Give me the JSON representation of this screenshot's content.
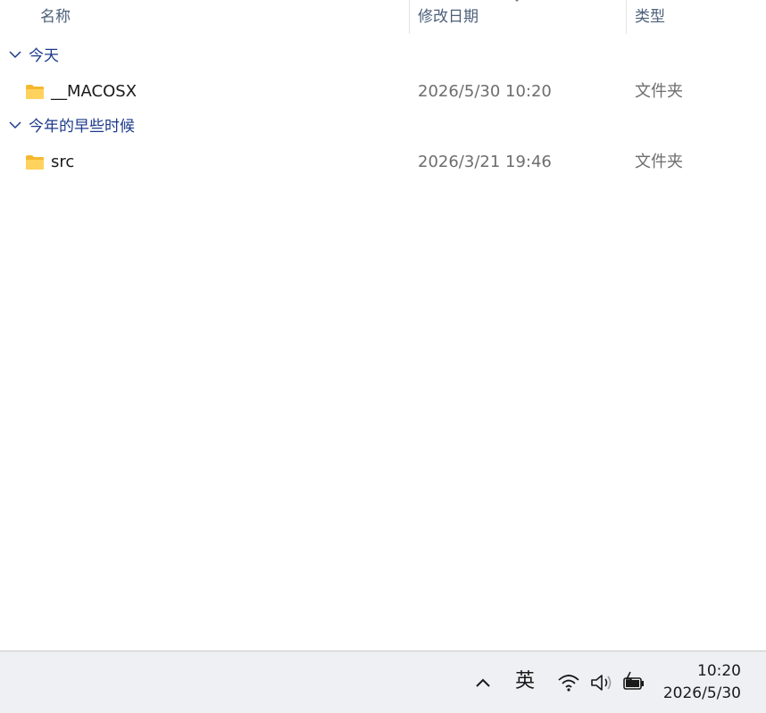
{
  "header": {
    "col_name": "名称",
    "col_date": "修改日期",
    "col_type": "类型"
  },
  "groups": [
    {
      "label": "今天",
      "rows": [
        {
          "name": "__MACOSX",
          "date": "2026/5/30 10:20",
          "type": "文件夹"
        }
      ]
    },
    {
      "label": "今年的早些时候",
      "rows": [
        {
          "name": "src",
          "date": "2026/3/21 19:46",
          "type": "文件夹"
        }
      ]
    }
  ],
  "taskbar": {
    "ime": "英",
    "time": "10:20",
    "date": "2026/5/30"
  },
  "icons": {
    "folder": "folder-icon",
    "expand": "chevron-down-icon",
    "wifi": "wifi-icon",
    "volume": "speaker-icon",
    "battery": "battery-charging-icon",
    "overflow": "chevron-up-icon"
  },
  "colors": {
    "group_label": "#1b3a8a",
    "folder": "#ffc83d",
    "taskbar": "#eef0f3"
  }
}
